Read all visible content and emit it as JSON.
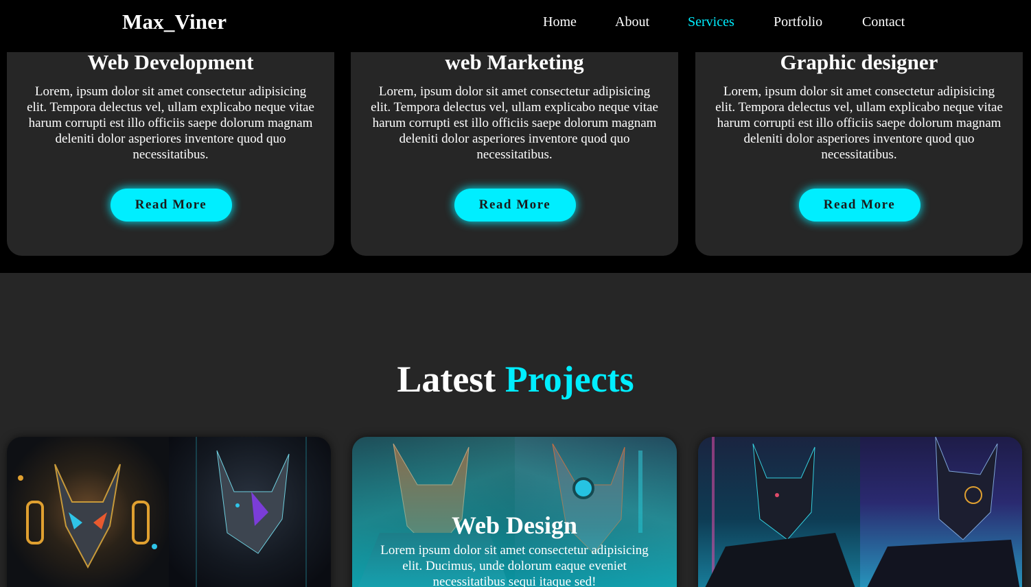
{
  "header": {
    "logo": "Max_Viner",
    "nav": [
      {
        "label": "Home"
      },
      {
        "label": "About"
      },
      {
        "label": "Services"
      },
      {
        "label": "Portfolio"
      },
      {
        "label": "Contact"
      }
    ],
    "active_nav": "Services"
  },
  "services": {
    "cards": [
      {
        "title": "Web Development",
        "text": "Lorem, ipsum dolor sit amet consectetur adipisicing elit. Tempora delectus vel, ullam explicabo neque vitae harum corrupti est illo officiis saepe dolorum magnam deleniti dolor asperiores inventore quod quo necessitatibus.",
        "button": "Read More"
      },
      {
        "title": "web Marketing",
        "text": "Lorem, ipsum dolor sit amet consectetur adipisicing elit. Tempora delectus vel, ullam explicabo neque vitae harum corrupti est illo officiis saepe dolorum magnam deleniti dolor asperiores inventore quod quo necessitatibus.",
        "button": "Read More"
      },
      {
        "title": "Graphic designer",
        "text": "Lorem, ipsum dolor sit amet consectetur adipisicing elit. Tempora delectus vel, ullam explicabo neque vitae harum corrupti est illo officiis saepe dolorum magnam deleniti dolor asperiores inventore quod quo necessitatibus.",
        "button": "Read More"
      }
    ]
  },
  "projects": {
    "heading_part1": "Latest",
    "heading_part2": "Projects",
    "featured": {
      "title": "Web Design",
      "text": "Lorem ipsum dolor sit amet consectetur adipisicing elit. Ducimus, unde dolorum eaque eveniet necessitatibus sequi itaque sed!"
    }
  },
  "colors": {
    "accent": "#00eeff",
    "background": "#262626",
    "header_bg": "#000000",
    "card_bg": "#262626"
  }
}
